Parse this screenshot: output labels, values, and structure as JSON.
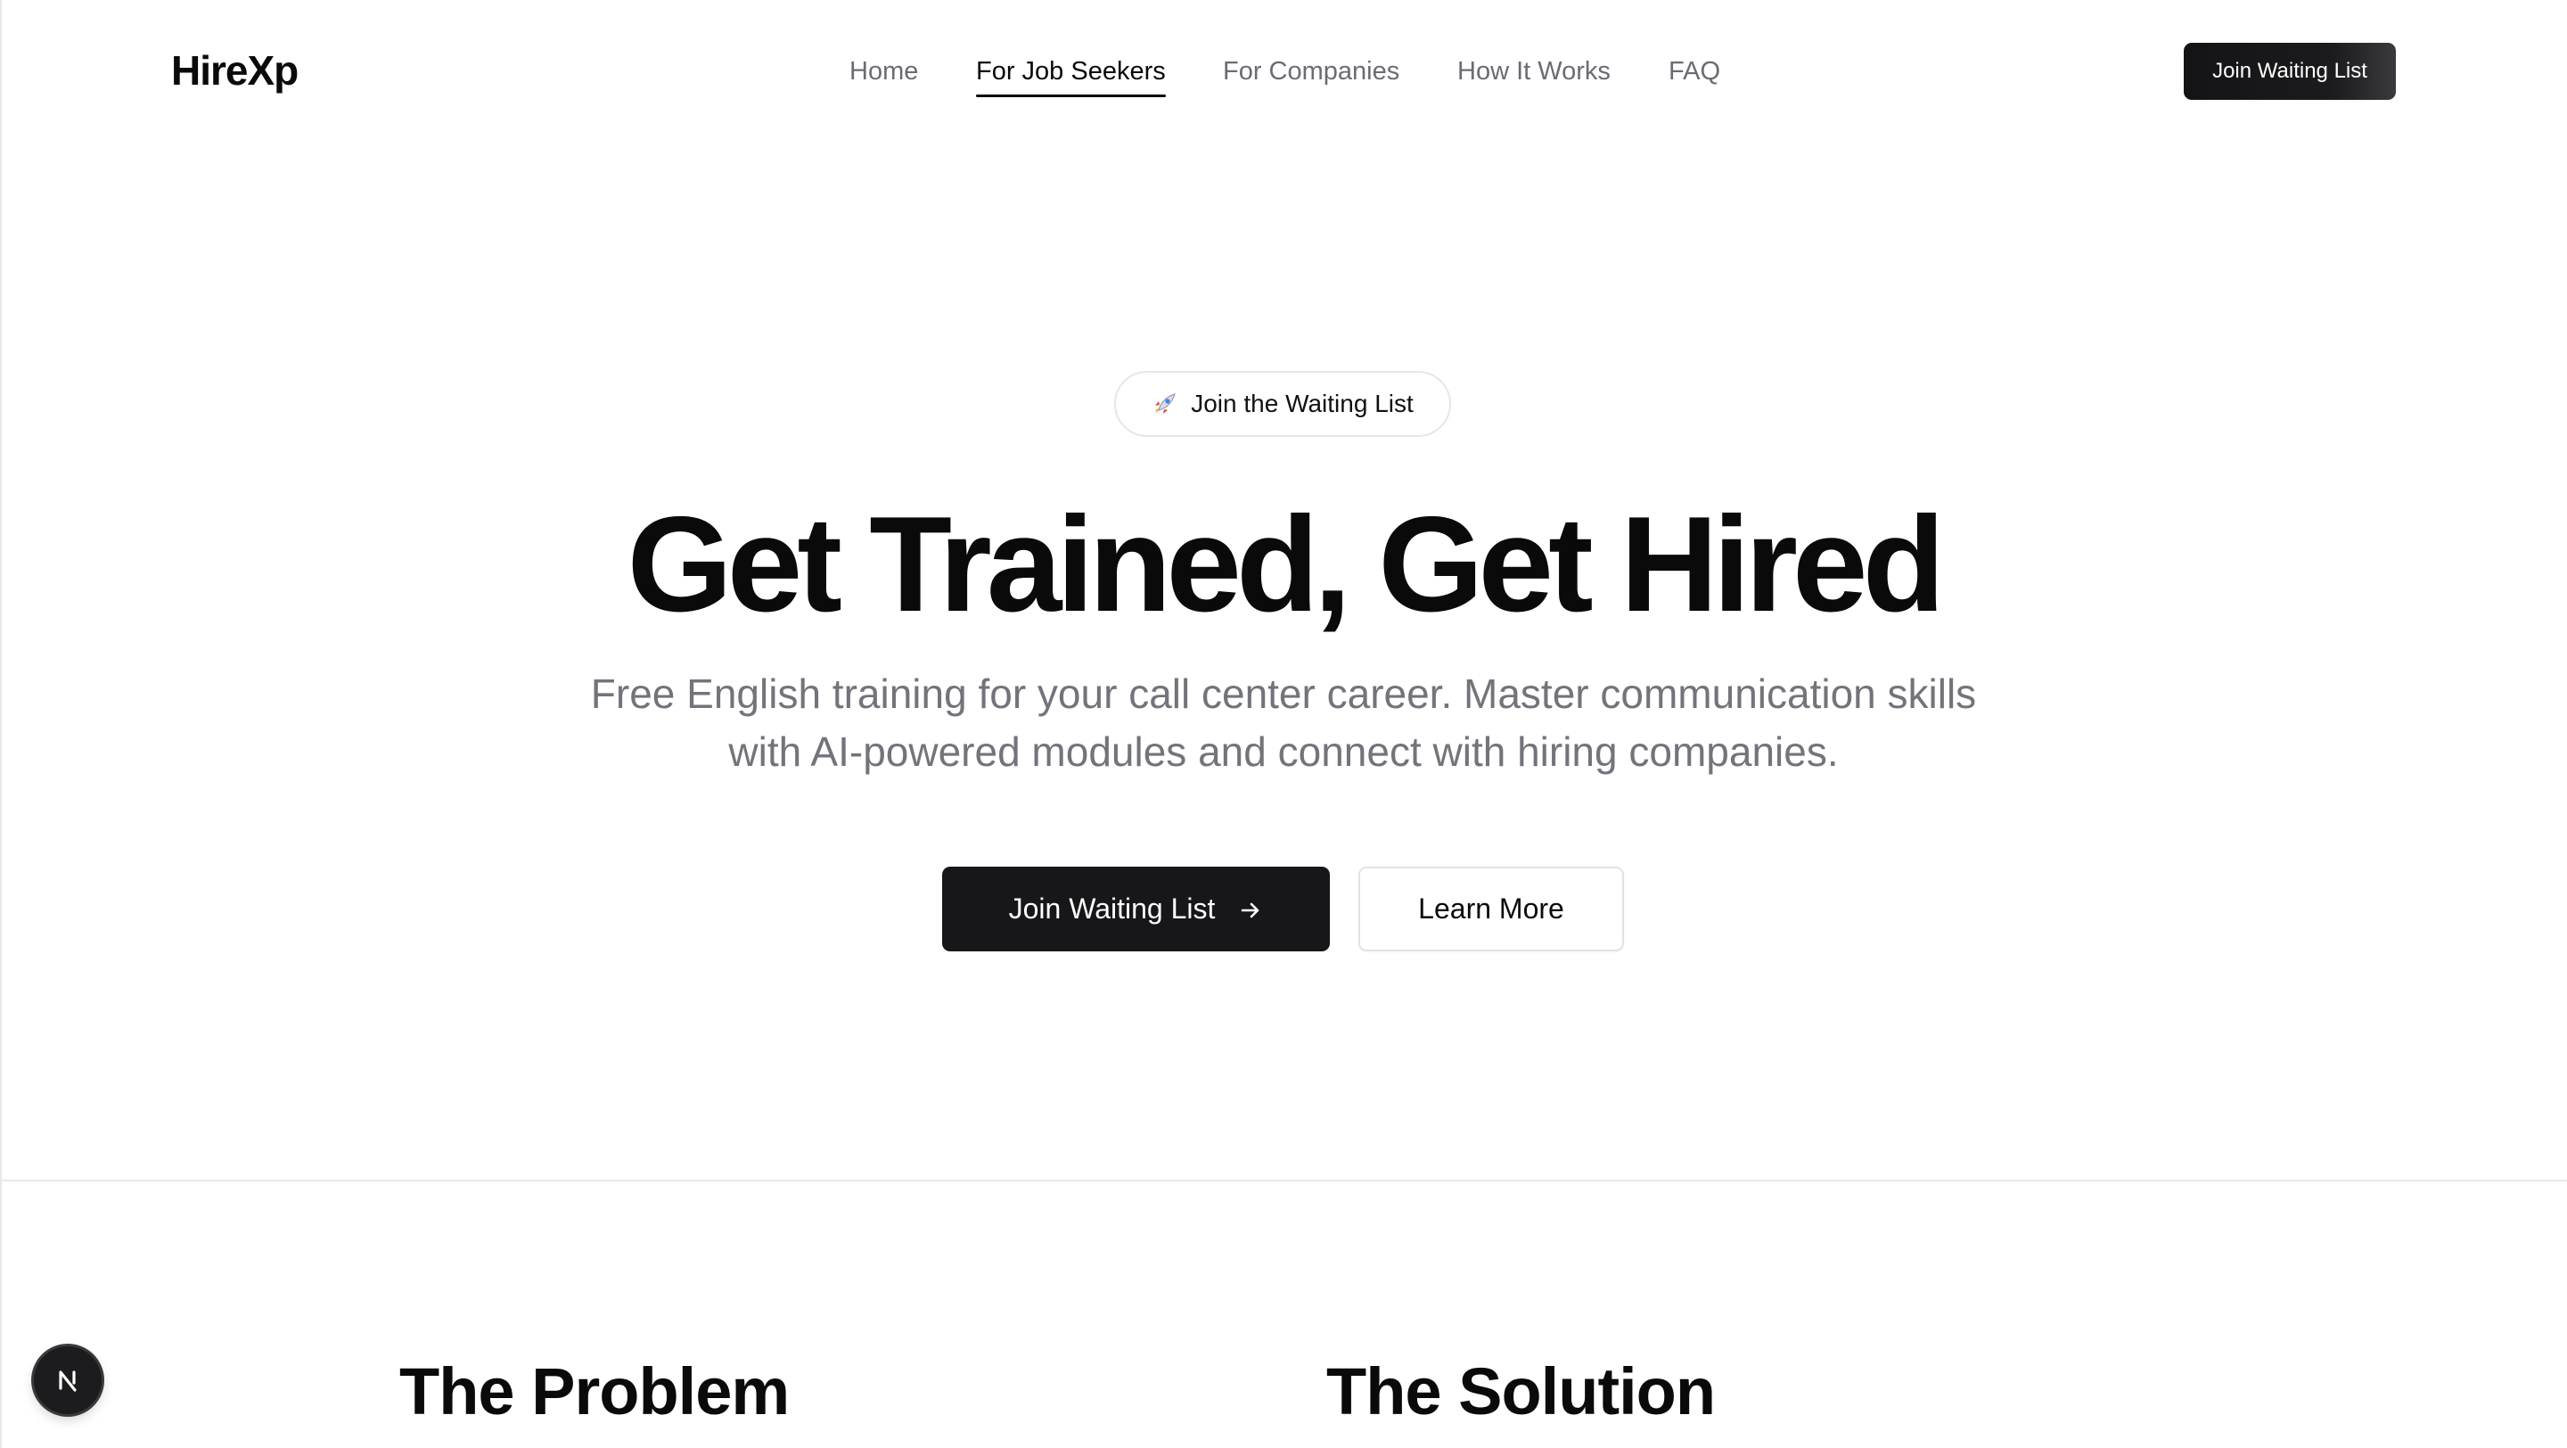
{
  "header": {
    "logo": "HireXp",
    "nav": [
      {
        "label": "Home",
        "active": false
      },
      {
        "label": "For Job Seekers",
        "active": true
      },
      {
        "label": "For Companies",
        "active": false
      },
      {
        "label": "How It Works",
        "active": false
      },
      {
        "label": "FAQ",
        "active": false
      }
    ],
    "cta_label": "Join Waiting List"
  },
  "hero": {
    "badge": {
      "icon": "rocket-icon",
      "label": "Join the Waiting List"
    },
    "title": "Get Trained, Get Hired",
    "subtitle": "Free English training for your call center career. Master communication skills with AI-powered modules and connect with hiring companies.",
    "primary_button": {
      "label": "Join Waiting List",
      "icon": "arrow-right-icon"
    },
    "secondary_button": {
      "label": "Learn More"
    }
  },
  "sections": {
    "problem_title": "The Problem",
    "solution_title": "The Solution"
  },
  "dev_badge": {
    "letter": "N"
  },
  "colors": {
    "primary": "#17171a",
    "text": "#0a0a0a",
    "muted": "#73737b",
    "border": "#e2e2e6"
  }
}
